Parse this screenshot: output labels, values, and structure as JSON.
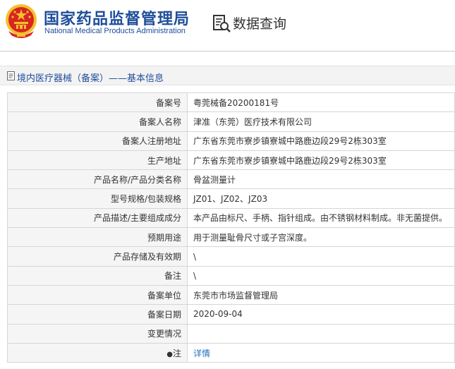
{
  "header": {
    "title_cn": "国家药品监督管理局",
    "title_en": "National Medical Products Administration",
    "query_title": "数据查询",
    "icons": {
      "emblem": "national-emblem-icon",
      "query": "document-search-icon"
    }
  },
  "breadcrumb": {
    "section": "境内医疗器械（备案）",
    "separator": "——",
    "page": "基本信息",
    "icon": "document-icon"
  },
  "rows": [
    {
      "label": "备案号",
      "value": "粤莞械备20200181号"
    },
    {
      "label": "备案人名称",
      "value": "津准（东莞）医疗技术有限公司"
    },
    {
      "label": "备案人注册地址",
      "value": "广东省东莞市寮步镇寮城中路鹿边段29号2栋303室"
    },
    {
      "label": "生产地址",
      "value": "广东省东莞市寮步镇寮城中路鹿边段29号2栋303室"
    },
    {
      "label": "产品名称/产品分类名称",
      "value": "骨盆测量计"
    },
    {
      "label": "型号规格/包装规格",
      "value": "JZ01、JZ02、JZ03"
    },
    {
      "label": "产品描述/主要组成成分",
      "value": "本产品由标尺、手柄、指针组成。由不锈钢材料制成。非无菌提供。"
    },
    {
      "label": "预期用途",
      "value": "用于测量耻骨尺寸或子宫深度。"
    },
    {
      "label": "产品存储及有效期",
      "value": "\\"
    },
    {
      "label": "备注",
      "value": "\\"
    },
    {
      "label": "备案单位",
      "value": "东莞市市场监督管理局"
    },
    {
      "label": "备案日期",
      "value": "2020-09-04"
    },
    {
      "label": "变更情况",
      "value": ""
    }
  ],
  "note_row": {
    "label": "注",
    "link": "详情",
    "icon": "pin-icon"
  },
  "colors": {
    "brand_blue": "#1f4e9a",
    "link_blue": "#1f6fc4",
    "emblem_red": "#d7261e",
    "emblem_gold": "#f3c030"
  }
}
